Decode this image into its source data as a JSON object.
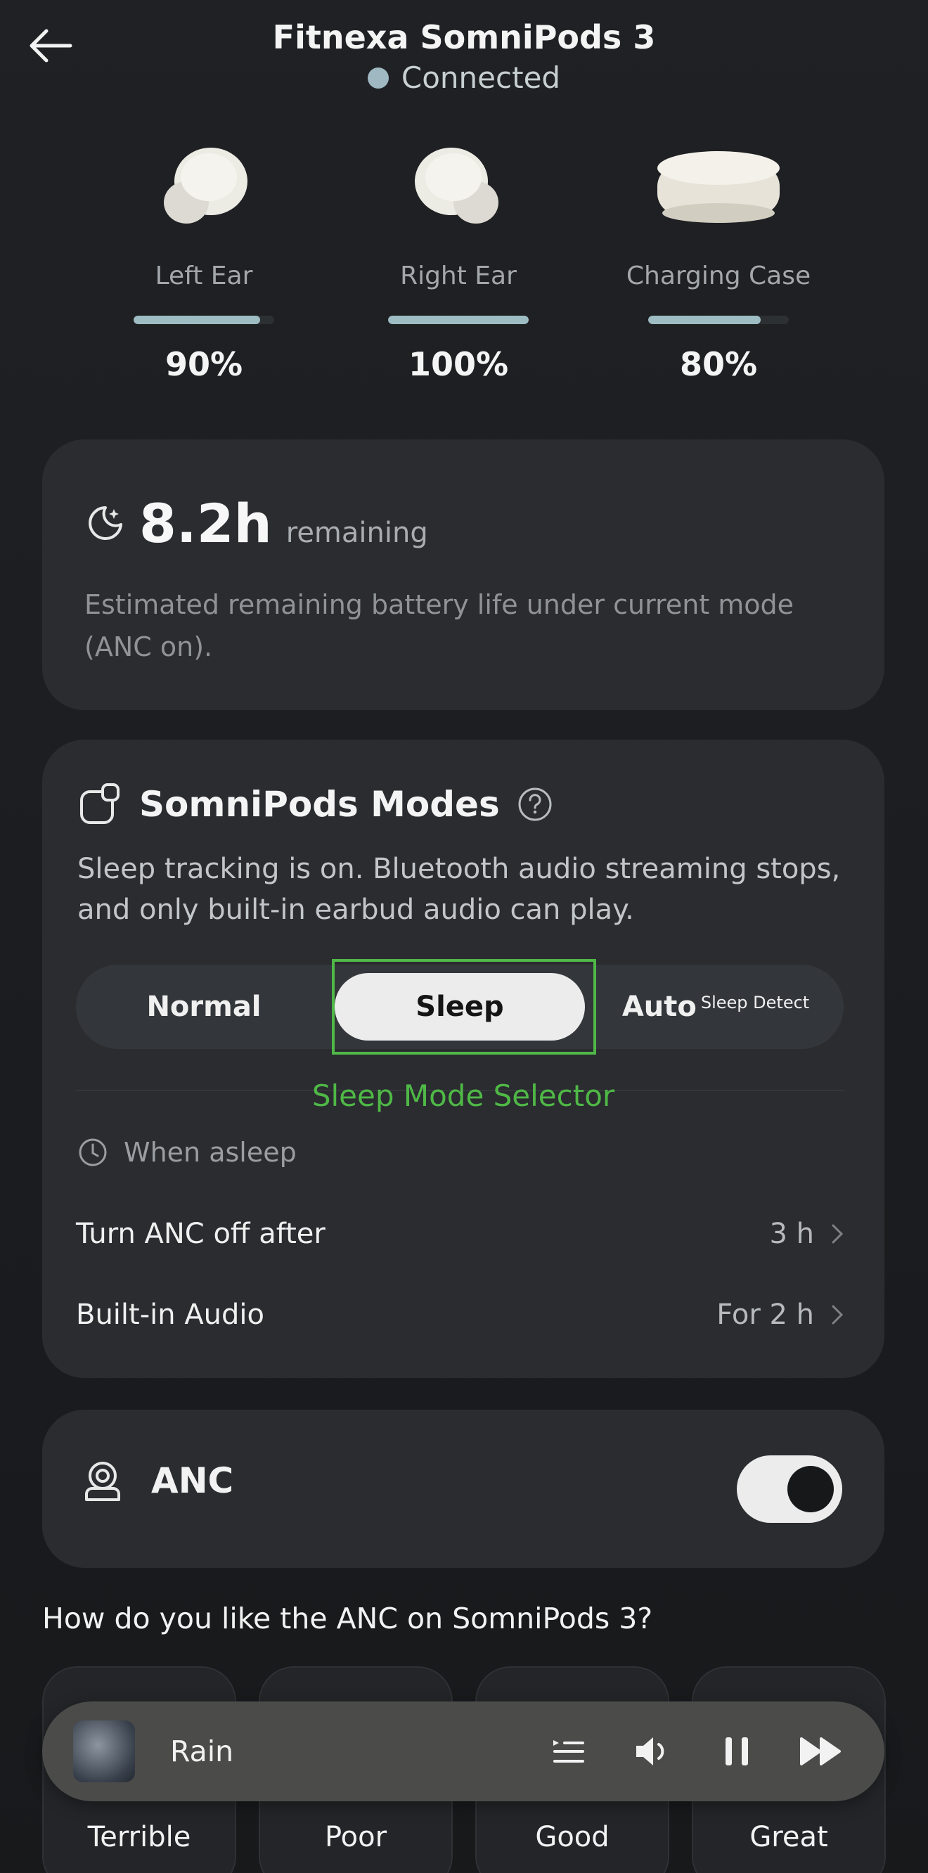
{
  "header": {
    "title": "Fitnexa SomniPods 3",
    "status": "Connected"
  },
  "devices": [
    {
      "label": "Left Ear",
      "percent_text": "90%",
      "level": 0.9
    },
    {
      "label": "Right Ear",
      "percent_text": "100%",
      "level": 1.0
    },
    {
      "label": "Charging Case",
      "percent_text": "80%",
      "level": 0.8
    }
  ],
  "battery": {
    "value": "8.2h",
    "unit": "remaining",
    "description": "Estimated remaining battery life under current mode (ANC on)."
  },
  "modes": {
    "title": "SomniPods Modes",
    "description": "Sleep tracking is on. Bluetooth audio streaming stops, and only built-in earbud audio can play.",
    "options": [
      "Normal",
      "Sleep",
      "Auto"
    ],
    "auto_superscript": "Sleep Detect",
    "selected": "Sleep",
    "annotation": "Sleep Mode Selector",
    "when_asleep_label": "When asleep",
    "rows": [
      {
        "label": "Turn ANC off after",
        "value": "3 h"
      },
      {
        "label": "Built-in Audio",
        "value": "For 2 h"
      }
    ]
  },
  "anc": {
    "label": "ANC",
    "enabled": true
  },
  "feedback": {
    "question": "How do you like the ANC on SomniPods 3?",
    "options": [
      "Terrible",
      "Poor",
      "Good",
      "Great"
    ]
  },
  "player": {
    "track": "Rain"
  },
  "colors": {
    "accent": "#9dbdc3",
    "annotation": "#4fb846",
    "card": "#2a2c30"
  }
}
